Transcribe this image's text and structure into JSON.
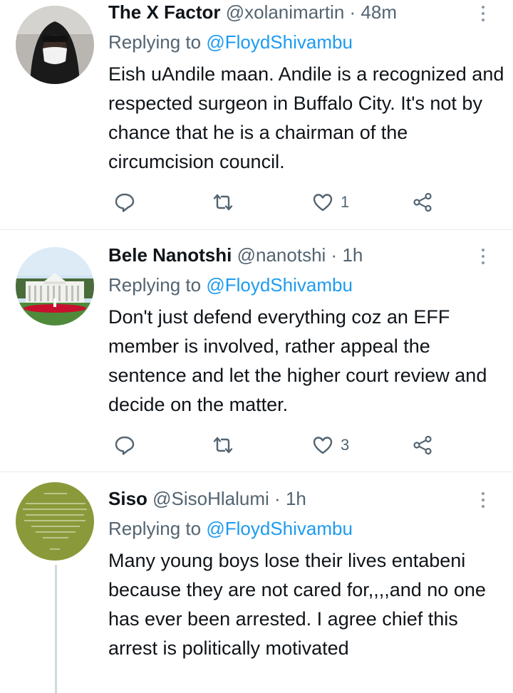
{
  "tweets": [
    {
      "name": "The X Factor",
      "handle": "@xolanimartin",
      "dot": "·",
      "time": "48m",
      "reply_prefix": "Replying to ",
      "reply_handle": "@FloydShivambu",
      "text": "Eish uAndile maan. Andile is a recognized and respected surgeon in Buffalo City. It's not by chance that he is a chairman of the circumcision council.",
      "likes": "1",
      "avatar_icon": "masked-person-avatar"
    },
    {
      "name": "Bele Nanotshi",
      "handle": "@nanotshi",
      "dot": "·",
      "time": "1h",
      "reply_prefix": "Replying to ",
      "reply_handle": "@FloydShivambu",
      "text": "Don't just defend everything coz an EFF member is involved, rather appeal the sentence and let the higher court review and decide on the matter.",
      "likes": "3",
      "avatar_icon": "white-house-avatar"
    },
    {
      "name": "Siso",
      "handle": "@SisoHlalumi",
      "dot": "·",
      "time": "1h",
      "reply_prefix": "Replying to ",
      "reply_handle": "@FloydShivambu",
      "text": "Many young boys lose their lives entabeni because they are not cared for,,,,and no one has ever been arrested. I agree chief this arrest is politically motivated",
      "avatar_icon": "green-text-avatar"
    }
  ],
  "colors": {
    "link": "#1d9bf0",
    "secondary_text": "#536471",
    "divider": "#e6e9eb",
    "avatar_green": "#8a9a3b"
  },
  "icons": [
    "reply-icon",
    "retweet-icon",
    "like-icon",
    "share-icon",
    "more-options-icon"
  ]
}
